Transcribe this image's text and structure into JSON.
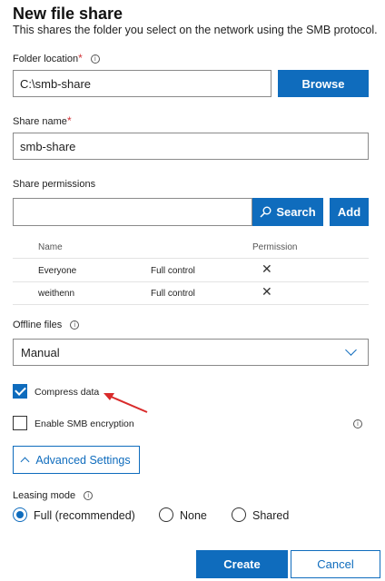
{
  "header": {
    "title": "New file share",
    "subtitle": "This shares the folder you select on the network using the SMB protocol."
  },
  "folder_location": {
    "label": "Folder location",
    "required_mark": "*",
    "value": "C:\\smb-share",
    "browse_label": "Browse",
    "info_icon": "info-icon"
  },
  "share_name": {
    "label": "Share name",
    "required_mark": "*",
    "value": "smb-share"
  },
  "share_permissions": {
    "label": "Share permissions",
    "search_value": "",
    "search_label": "Search",
    "add_label": "Add",
    "columns": [
      "Name",
      "Permission"
    ],
    "rows": [
      {
        "name": "Everyone",
        "permission": "Full control"
      },
      {
        "name": "weithenn",
        "permission": "Full control"
      }
    ]
  },
  "offline_files": {
    "label": "Offline files",
    "selected": "Manual"
  },
  "compress_data": {
    "label": "Compress data",
    "checked": true
  },
  "smb_encryption": {
    "label": "Enable SMB encryption",
    "checked": false
  },
  "advanced": {
    "label": "Advanced Settings"
  },
  "leasing_mode": {
    "label": "Leasing mode",
    "options": [
      "Full (recommended)",
      "None",
      "Shared"
    ],
    "selected": "Full (recommended)"
  },
  "footer": {
    "create_label": "Create",
    "cancel_label": "Cancel"
  },
  "colors": {
    "accent": "#0f6cbd",
    "required": "#d13438",
    "annotation_arrow": "#d92b2b"
  }
}
